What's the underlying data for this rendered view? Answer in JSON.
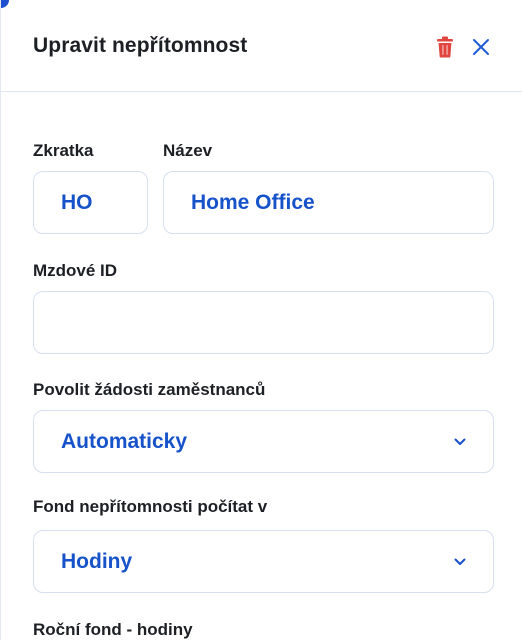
{
  "dialog": {
    "title": "Upravit nepřítomnost",
    "delete_icon": "trash-icon",
    "close_icon": "close-icon"
  },
  "form": {
    "abbreviation": {
      "label": "Zkratka",
      "value": "HO"
    },
    "name": {
      "label": "Název",
      "value": "Home Office"
    },
    "payroll_id": {
      "label": "Mzdové ID",
      "value": ""
    },
    "allow_requests": {
      "label": "Povolit žádosti zaměstnanců",
      "value": "Automaticky"
    },
    "fund_unit": {
      "label": "Fond nepřítomnosti počítat v",
      "value": "Hodiny"
    },
    "annual_fund": {
      "label": "Roční fond - hodiny"
    }
  },
  "colors": {
    "accent": "#1652c9",
    "delete": "#e0463f",
    "close": "#1f5bd6",
    "border": "#d6e0ee",
    "text": "#1c1f24"
  }
}
